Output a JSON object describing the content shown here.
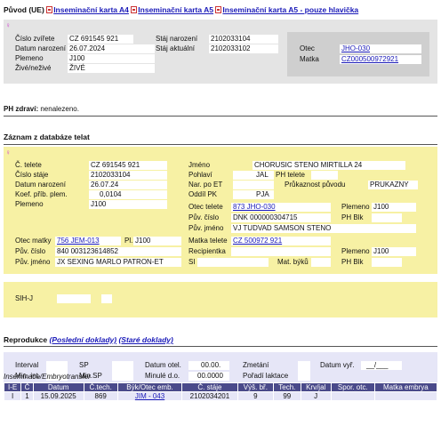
{
  "header": {
    "title": "Původ (UE)",
    "links": [
      "Inseminační karta A4",
      "Inseminační karta A5",
      "Inseminační karta A5 - pouze hlavička"
    ]
  },
  "origin": {
    "cislo_zvirete_label": "Číslo zvířete",
    "cislo_zvirete": "CZ 691545 921",
    "datum_narozeni_label": "Datum narození",
    "datum_narozeni": "26.07.2024",
    "plemeno_label": "Plemeno",
    "plemeno": "J100",
    "zive_label": "Živé/neživé",
    "zive": "ŽIVÉ",
    "staj_narozeni_label": "Stáj narození",
    "staj_narozeni": "2102033104",
    "staj_aktualni_label": "Stáj aktuální",
    "staj_aktualni": "2102033102",
    "otec_label": "Otec",
    "otec": "JHO-030",
    "matka_label": "Matka",
    "matka": "CZ000500972921"
  },
  "ph": {
    "label": "PH zdraví:",
    "value": "nenalezeno."
  },
  "calves": {
    "title": "Záznam z databáze telat",
    "c_telete_label": "Č. telete",
    "c_telete": "CZ 691545 921",
    "cislo_staje_label": "Číslo stáje",
    "cislo_staje": "2102033104",
    "datum_narozeni_label": "Datum narození",
    "datum_narozeni": "26.07.24",
    "koef_label": "Koef. příb. plem.",
    "koef": "0,0104",
    "plemeno_label": "Plemeno",
    "plemeno": "J100",
    "jmeno_label": "Jméno",
    "jmeno": "CHORUSIC STENO MIRTILLA 24",
    "pohlavi_label": "Pohlaví",
    "pohlavi": "JAL",
    "ph_telete_label": "PH telete",
    "nar_po_et_label": "Nar. po ET",
    "pruk_label": "Průkaznost původu",
    "pruk": "PRUKAZNY",
    "oddil_label": "Oddíl PK",
    "oddil": "PJA",
    "otec_telete_label": "Otec telete",
    "otec_telete": "873 JHO-030",
    "plemeno2_label": "Plemeno",
    "plemeno2": "J100",
    "puv_cislo_label": "Pův. číslo",
    "puv_cislo": "DNK 000000304715",
    "ph_blk_label": "PH Blk",
    "puv_jmeno_label": "Pův. jméno",
    "puv_jmeno": "VJ TUDVAD SAMSON STENO",
    "otec_matky_label": "Otec matky",
    "otec_matky": "756 JEM-013",
    "pl_label": "Pl.",
    "pl": "J100",
    "matka_telete_label": "Matka telete",
    "matka_telete": "CZ 500972 921",
    "puv_cislo2_label": "Pův. číslo",
    "puv_cislo2": "840 003123614852",
    "recipientka_label": "Recipientka",
    "plemeno3_label": "Plemeno",
    "plemeno3": "J100",
    "puv_jmeno2_label": "Pův. jméno",
    "puv_jmeno2": "JX SEXING MARLO PATRON-ET",
    "si_label": "SI",
    "mat_byku_label": "Mat. býků",
    "ph_blk2_label": "PH Blk",
    "sih_label": "SIH-J"
  },
  "repro": {
    "title": "Reprodukce",
    "link1": "(Poslední doklady)",
    "link2": "(Staré doklady)",
    "interval_label": "Interval",
    "min_int_label": "Min. int.",
    "sp_label": "SP",
    "min_sp_label": "Min.SP",
    "datum_otel_label": "Datum otel.",
    "datum_otel": "00.00.",
    "minule_label": "Minulé d.o.",
    "minule": "00.0000",
    "zmetani_label": "Zmetání",
    "poradi_label": "Pořadí laktace",
    "datum_vyr_label": "Datum vyř.",
    "datum_vyr": "__/___"
  },
  "embryo": {
    "title": "Inseminace/Embryotransfer",
    "columns": [
      "I-E",
      "Č",
      "Datum",
      "Č.tech.",
      "Býk/Otec emb.",
      "Č. stáje",
      "Výš. bř.",
      "Tech.",
      "Krv/jal",
      "Spor. otc.",
      "Matka embrya"
    ],
    "rows": [
      [
        "I",
        "1",
        "15.09.2025",
        "869",
        "JIM - 043",
        "2102034201",
        "9",
        "99",
        "J",
        "",
        ""
      ]
    ]
  }
}
